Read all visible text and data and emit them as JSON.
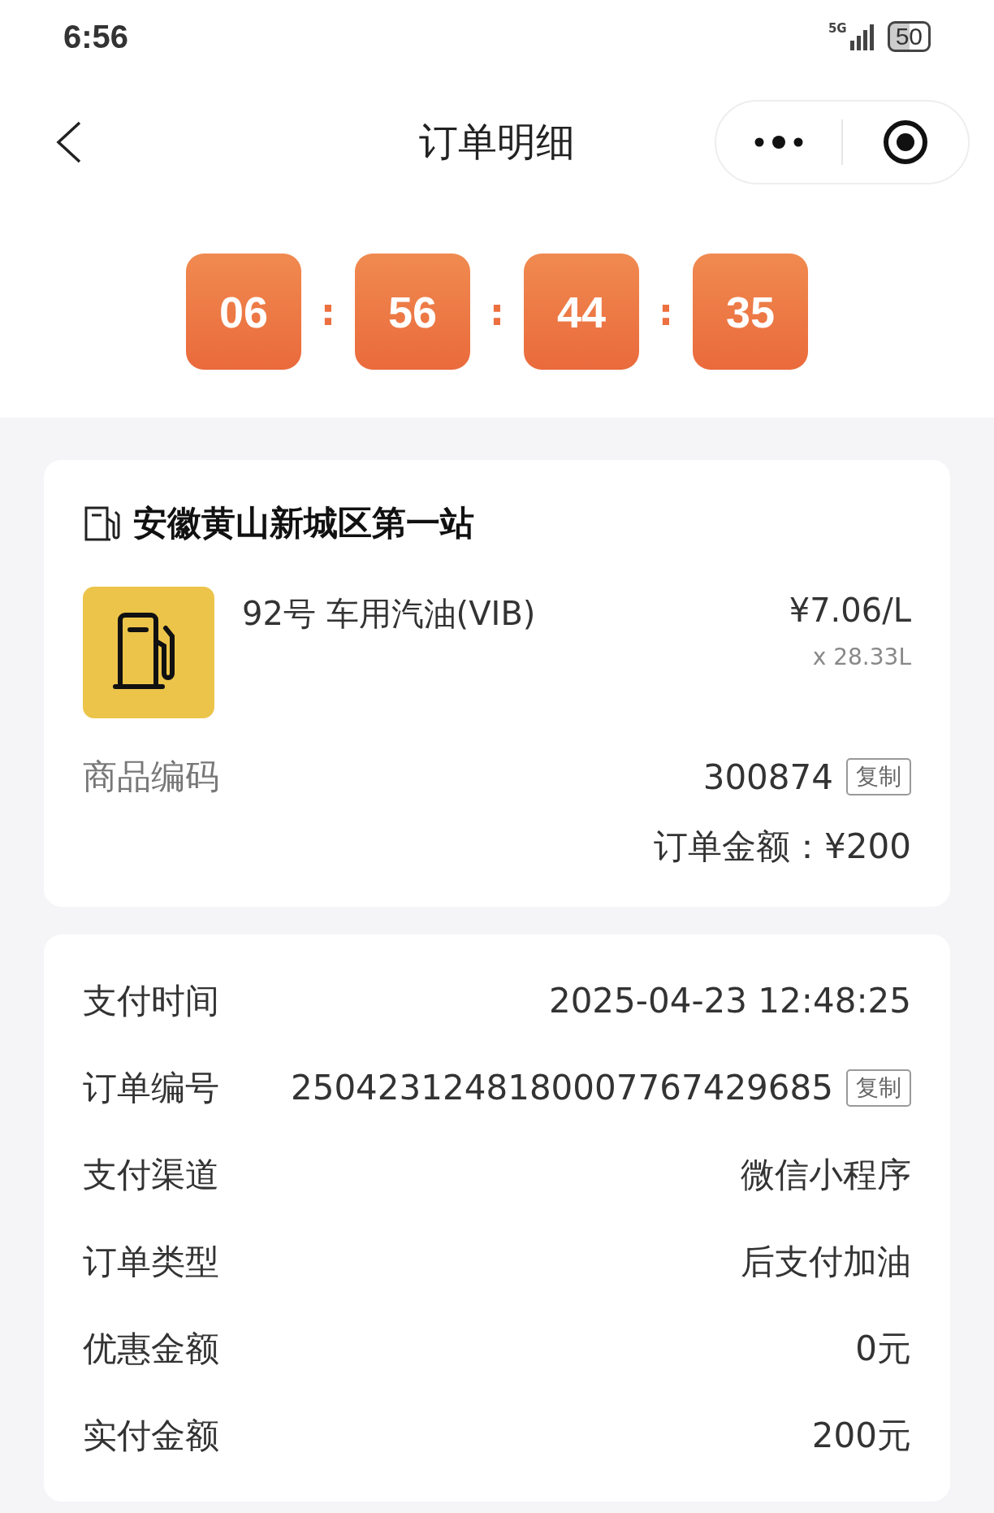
{
  "status_bar": {
    "time": "6:56",
    "network": "5G",
    "battery": "50"
  },
  "nav": {
    "title": "订单明细"
  },
  "countdown": {
    "segments": [
      "06",
      "56",
      "44",
      "35"
    ],
    "separator": ":"
  },
  "station": {
    "name": "安徽黄山新城区第一站",
    "product": {
      "name": "92号 车用汽油(VIB)",
      "unit_price": "¥7.06/L",
      "quantity": "x 28.33L"
    },
    "code_label": "商品编码",
    "code": "300874",
    "copy_label": "复制",
    "total": "订单金额：¥200"
  },
  "details": [
    {
      "label": "支付时间",
      "value": "2025-04-23 12:48:25"
    },
    {
      "label": "订单编号",
      "value": "2504231248180007767429685",
      "copy": "复制"
    },
    {
      "label": "支付渠道",
      "value": "微信小程序"
    },
    {
      "label": "订单类型",
      "value": "后支付加油"
    },
    {
      "label": "优惠金额",
      "value": "0元"
    },
    {
      "label": "实付金额",
      "value": "200元"
    }
  ]
}
